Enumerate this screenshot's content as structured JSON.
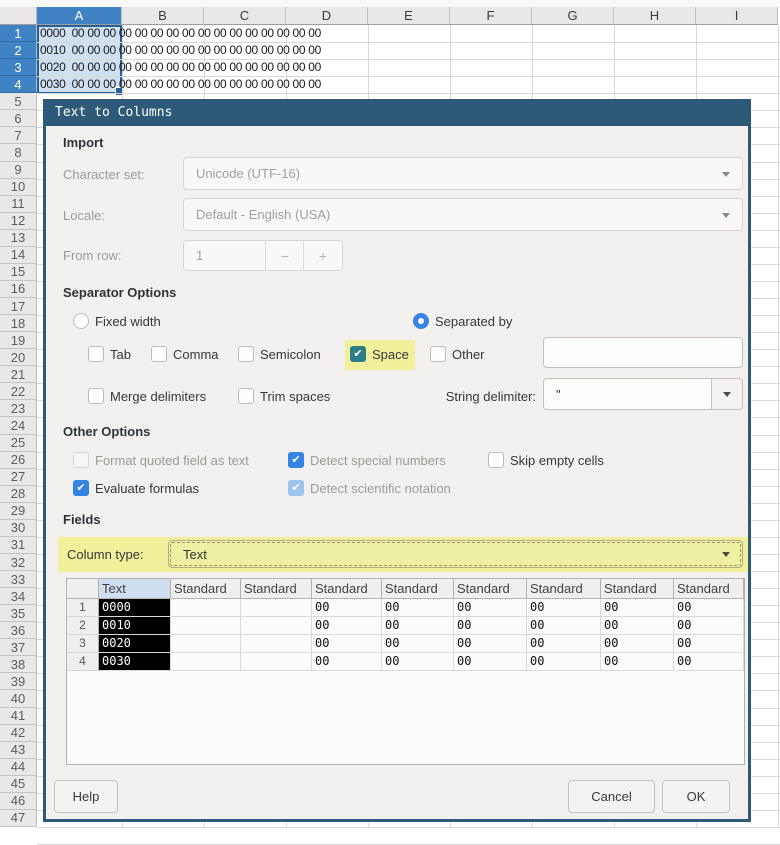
{
  "colors": {
    "titlebar": "#2d5a78",
    "highlight_yellow": "#f1f19c",
    "accent_blue": "#3584e4",
    "space_check_teal": "#2e7e86",
    "selected_header_blue": "#3f83c5",
    "selection_fill": "#cfe0f1"
  },
  "sheet": {
    "column_headers": [
      "A",
      "B",
      "C",
      "D",
      "E",
      "F",
      "G",
      "H",
      "I"
    ],
    "selected_column": "A",
    "row_count": 47,
    "selected_rows_from": 1,
    "selected_rows_to": 4,
    "rows": [
      {
        "n": 1,
        "text": "0000  00 00 00 00 00 00 00 00 00 00 00 00 00 00 00 00"
      },
      {
        "n": 2,
        "text": "0010  00 00 00 00 00 00 00 00 00 00 00 00 00 00 00 00"
      },
      {
        "n": 3,
        "text": "0020  00 00 00 00 00 00 00 00 00 00 00 00 00 00 00 00"
      },
      {
        "n": 4,
        "text": "0030  00 00 00 00 00 00 00 00 00 00 00 00 00 00 00 00"
      }
    ]
  },
  "dialog": {
    "title": "Text to Columns",
    "import": {
      "section": "Import",
      "charset_label": "Character set:",
      "charset_value": "Unicode (UTF-16)",
      "locale_label": "Locale:",
      "locale_value": "Default - English (USA)",
      "from_row_label": "From row:",
      "from_row_value": "1",
      "minus": "−",
      "plus": "+"
    },
    "separator": {
      "section": "Separator Options",
      "fixed_width": "Fixed width",
      "separated_by": "Separated by",
      "tab": "Tab",
      "comma": "Comma",
      "semicolon": "Semicolon",
      "space": "Space",
      "other": "Other",
      "other_value": "",
      "merge": "Merge delimiters",
      "trim": "Trim spaces",
      "string_delimiter_label": "String delimiter:",
      "string_delimiter_value": "\""
    },
    "other": {
      "section": "Other Options",
      "format_quoted": "Format quoted field as text",
      "detect_special": "Detect special numbers",
      "skip_empty": "Skip empty cells",
      "evaluate": "Evaluate formulas",
      "detect_sci": "Detect scientific notation"
    },
    "fields": {
      "section": "Fields",
      "column_type_label": "Column type:",
      "column_type_value": "Text"
    },
    "state": {
      "fixed_width": false,
      "separated_by": true,
      "tab": false,
      "comma": false,
      "semicolon": false,
      "space": true,
      "other": false,
      "merge": false,
      "trim": false,
      "format_quoted": false,
      "detect_special": true,
      "skip_empty": false,
      "evaluate": true,
      "detect_sci": true
    },
    "preview": {
      "headers": [
        "",
        "Text",
        "Standard",
        "Standard",
        "Standard",
        "Standard",
        "Standard",
        "Standard",
        "Standard",
        "Standard"
      ],
      "rows": [
        {
          "n": "1",
          "cells": [
            "0000",
            "",
            "",
            "00",
            "00",
            "00",
            "00",
            "00",
            "00"
          ]
        },
        {
          "n": "2",
          "cells": [
            "0010",
            "",
            "",
            "00",
            "00",
            "00",
            "00",
            "00",
            "00"
          ]
        },
        {
          "n": "3",
          "cells": [
            "0020",
            "",
            "",
            "00",
            "00",
            "00",
            "00",
            "00",
            "00"
          ]
        },
        {
          "n": "4",
          "cells": [
            "0030",
            "",
            "",
            "00",
            "00",
            "00",
            "00",
            "00",
            "00"
          ]
        }
      ]
    },
    "buttons": {
      "help": "Help",
      "cancel": "Cancel",
      "ok": "OK"
    }
  }
}
